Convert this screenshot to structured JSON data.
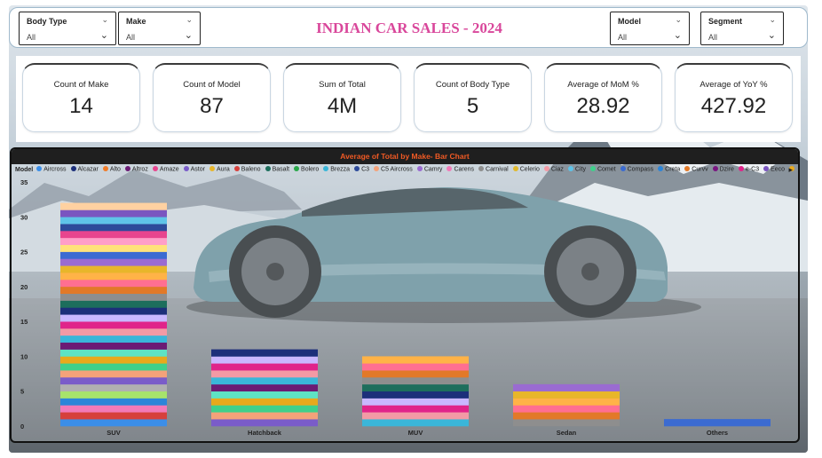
{
  "filters": {
    "body_type": {
      "label": "Body Type",
      "value": "All"
    },
    "make": {
      "label": "Make",
      "value": "All"
    },
    "model": {
      "label": "Model",
      "value": "All"
    },
    "segment": {
      "label": "Segment",
      "value": "All"
    }
  },
  "title": "INDIAN CAR SALES - 2024",
  "kpis": [
    {
      "label": "Count of Make",
      "value": "14"
    },
    {
      "label": "Count of Model",
      "value": "87"
    },
    {
      "label": "Sum of Total",
      "value": "4M"
    },
    {
      "label": "Count of Body Type",
      "value": "5"
    },
    {
      "label": "Average of MoM %",
      "value": "28.92"
    },
    {
      "label": "Average of YoY %",
      "value": "427.92"
    }
  ],
  "icons": {
    "dropdown": "chevron-down-icon",
    "legend_scroll": "chevron-right-icon"
  },
  "colors": {
    "title": "#d9479b",
    "chart_title": "#f15a24"
  },
  "legend": {
    "title": "Model",
    "items": [
      {
        "name": "Aircross",
        "color": "#3b8ee8"
      },
      {
        "name": "Alcazar",
        "color": "#1c2f7a"
      },
      {
        "name": "Alto",
        "color": "#f07c2a"
      },
      {
        "name": "Altroz",
        "color": "#6b1b74"
      },
      {
        "name": "Amaze",
        "color": "#e8458e"
      },
      {
        "name": "Astor",
        "color": "#7a5cc9"
      },
      {
        "name": "Aura",
        "color": "#e8b62a"
      },
      {
        "name": "Baleno",
        "color": "#d6403c"
      },
      {
        "name": "Basalt",
        "color": "#1d6e5c"
      },
      {
        "name": "Bolero",
        "color": "#2aa84a"
      },
      {
        "name": "Brezza",
        "color": "#3ab6d9"
      },
      {
        "name": "C3",
        "color": "#2d4a9a"
      },
      {
        "name": "C5 Aircross",
        "color": "#f4a27a"
      },
      {
        "name": "Camry",
        "color": "#9a6bd1"
      },
      {
        "name": "Carens",
        "color": "#f27ab8"
      },
      {
        "name": "Carnival",
        "color": "#8e8e8e"
      },
      {
        "name": "Celerio",
        "color": "#e0b92e"
      },
      {
        "name": "Ciaz",
        "color": "#f39aa5"
      },
      {
        "name": "City",
        "color": "#5fc3e8"
      },
      {
        "name": "Comet",
        "color": "#3fd08b"
      },
      {
        "name": "Compass",
        "color": "#3b6bd1"
      },
      {
        "name": "Creta",
        "color": "#2c85d8"
      },
      {
        "name": "Curvv",
        "color": "#e27928"
      },
      {
        "name": "Dzire",
        "color": "#7a1580"
      },
      {
        "name": "e-C3",
        "color": "#e0248a"
      },
      {
        "name": "Eeco",
        "color": "#7a55c0"
      },
      {
        "name": "Elevate",
        "color": "#e8a91c"
      }
    ]
  },
  "chart_data": {
    "type": "bar",
    "title": "Average of Total by Make- Bar Chart",
    "stacked": true,
    "categories": [
      "SUV",
      "Hatchback",
      "MUV",
      "Sedan",
      "Others"
    ],
    "values": [
      32,
      11,
      10,
      6,
      1
    ],
    "ylim": [
      0,
      35
    ],
    "yticks": [
      0,
      5,
      10,
      15,
      20,
      25,
      30,
      35
    ],
    "legend_position": "top",
    "grid": false
  }
}
